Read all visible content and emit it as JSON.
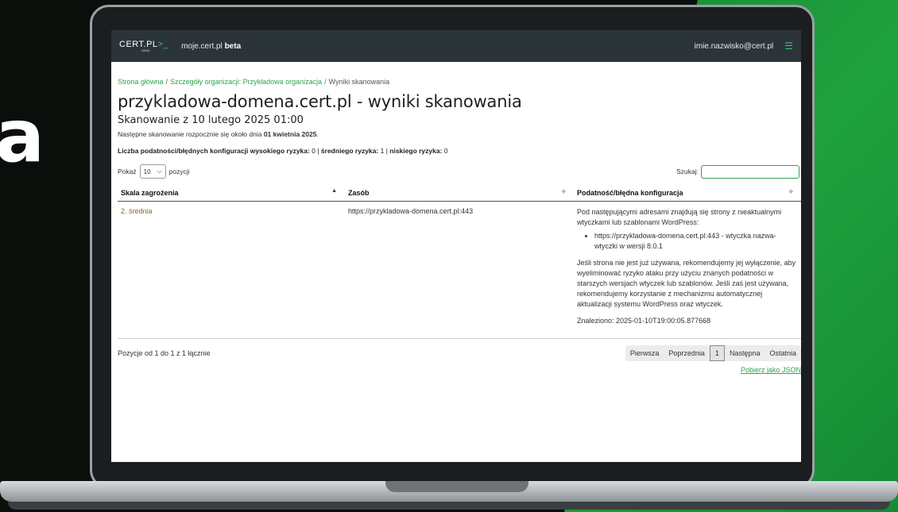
{
  "background": {
    "accent_color": "#1fa23e",
    "glyph": "a"
  },
  "app": {
    "logo_text": "CERT.PL",
    "logo_accent": ">_",
    "logo_sub": "NASK",
    "site_name": "moje.cert.pl",
    "site_badge": "beta",
    "user_email": "imie.nazwisko@cert.pl",
    "menu_icon": "hamburger-icon"
  },
  "breadcrumb": {
    "items": [
      "Strona główna",
      "Szczegóły organizacji: Przykładowa organizacja"
    ],
    "current": "Wyniki skanowania",
    "separator": "/"
  },
  "page": {
    "title": "przykladowa-domena.cert.pl - wyniki skanowania",
    "subtitle": "Skanowanie z 10 lutego 2025 01:00",
    "next_scan_prefix": "Następne skanowanie rozpocznie się około dnia ",
    "next_scan_date": "01 kwietnia 2025",
    "next_scan_suffix": "."
  },
  "counts": {
    "high_label": "Liczba podatności/błędnych konfiguracji wysokiego ryzyka:",
    "high_value": "0",
    "medium_label": "średniego ryzyka:",
    "medium_value": "1",
    "low_label": "niskiego ryzyka:",
    "low_value": "0",
    "sep": "|"
  },
  "controls": {
    "show_label": "Pokaż",
    "show_value": "10",
    "entries_label": "pozycji",
    "search_label": "Szukaj:",
    "search_value": ""
  },
  "table": {
    "headers": [
      "Skala zagrożenia",
      "Zasób",
      "Podatność/błędna konfiguracja"
    ],
    "rows": [
      {
        "severity": "2. średnia",
        "resource": "https://przykladowa-domena.cert.pl:443",
        "desc_intro": "Pod następującymi adresami znajdują się strony z nieaktualnymi wtyczkami lub szablonami WordPress:",
        "desc_item": "https://przykladowa-domena.cert.pl:443 - wtyczka nazwa-wtyczki w wersji 8.0.1",
        "desc_advice": "Jeśli strona nie jest już używana, rekomendujemy jej wyłączenie, aby wyeliminować ryzyko ataku przy użyciu znanych podatności w starszych wersjach wtyczek lub szablonów. Jeśli zaś jest używana, rekomendujemy korzystanie z mechanizmu automatycznej aktualizacji systemu WordPress oraz wtyczek.",
        "found": "Znaleziono: 2025-01-10T19:00:05.877668"
      }
    ]
  },
  "footer": {
    "info": "Pozycje od 1 do 1 z 1 łącznie",
    "pager": {
      "first": "Pierwsza",
      "prev": "Poprzednia",
      "current": "1",
      "next": "Następna",
      "last": "Ostatnia"
    },
    "json_link": "Pobierz jako JSON"
  }
}
